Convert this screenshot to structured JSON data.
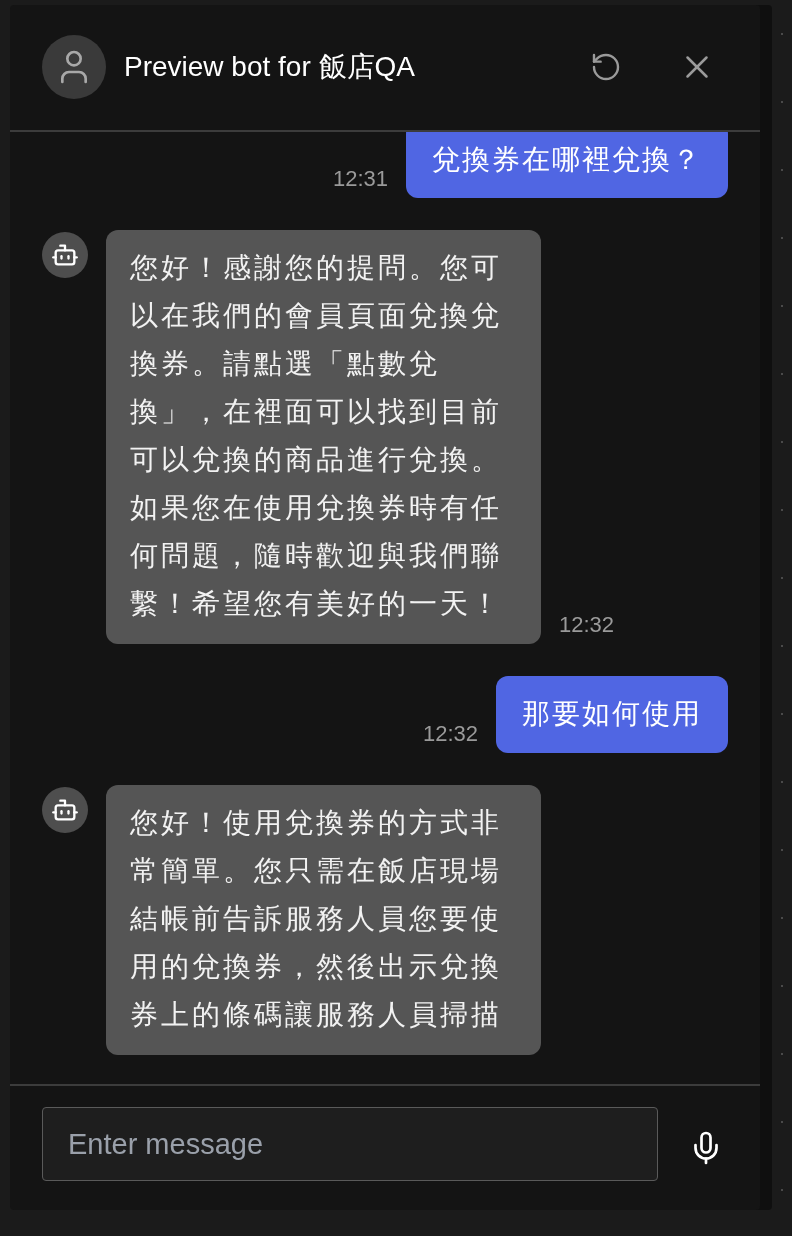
{
  "header": {
    "title": "Preview bot for 飯店QA"
  },
  "messages": [
    {
      "kind": "user",
      "text": "兌換券在哪裡兌換？",
      "time": "12:31"
    },
    {
      "kind": "bot",
      "text": "您好！感謝您的提問。您可以在我們的會員頁面兌換兌換券。請點選「點數兌換」，在裡面可以找到目前可以兌換的商品進行兌換。如果您在使用兌換券時有任何問題，隨時歡迎與我們聯繫！希望您有美好的一天！",
      "time": "12:32"
    },
    {
      "kind": "user",
      "text": "那要如何使用",
      "time": "12:32"
    },
    {
      "kind": "bot",
      "text": "您好！使用兌換券的方式非常簡單。您只需在飯店現場結帳前告訴服務人員您要使用的兌換券，然後出示兌換券上的條碼讓服務人員掃描"
    }
  ],
  "composer": {
    "placeholder": "Enter message"
  }
}
